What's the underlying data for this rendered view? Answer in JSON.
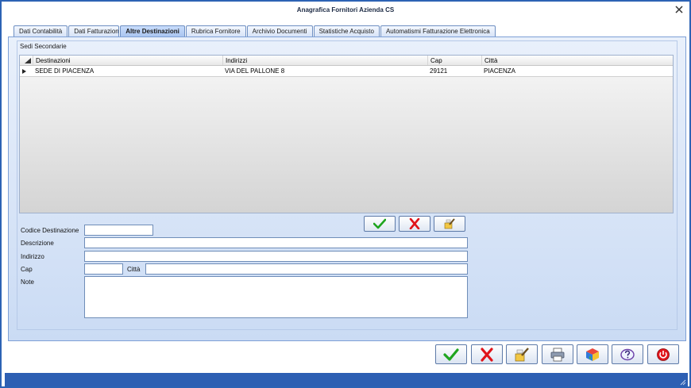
{
  "window": {
    "title": "Anagrafica Fornitori Azienda CS"
  },
  "tabs": [
    {
      "label": "Dati Contabilità"
    },
    {
      "label": "Dati Fatturazione"
    },
    {
      "label": "Altre Destinazioni"
    },
    {
      "label": "Rubrica Fornitore"
    },
    {
      "label": "Archivio Documenti"
    },
    {
      "label": "Statistiche Acquisto"
    },
    {
      "label": "Automatismi Fatturazione Elettronica"
    }
  ],
  "group": {
    "label": "Sedi Secondarie"
  },
  "grid": {
    "columns": [
      "Destinazioni",
      "Indirizzi",
      "Cap",
      "Città"
    ],
    "rows": [
      [
        "SEDE DI PIACENZA",
        "VIA DEL PALLONE 8",
        "29121",
        "PIACENZA"
      ]
    ]
  },
  "form": {
    "codice_label": "Codice Destinazione",
    "descrizione_label": "Descrizione",
    "indirizzo_label": "Indirizzo",
    "cap_label": "Cap",
    "citta_label": "Città",
    "note_label": "Note",
    "codice_value": "",
    "descrizione_value": "",
    "indirizzo_value": "",
    "cap_value": "",
    "citta_value": "",
    "note_value": ""
  },
  "icons": {
    "confirm": "check-icon",
    "cancel": "x-icon",
    "clear": "eraser-icon",
    "print": "printer-icon",
    "cube": "cube-icon",
    "help": "help-icon",
    "exit": "exit-icon"
  },
  "colors": {
    "accent": "#2d5fb3",
    "confirm_green": "#1fa51f",
    "cancel_red": "#e0141a"
  }
}
